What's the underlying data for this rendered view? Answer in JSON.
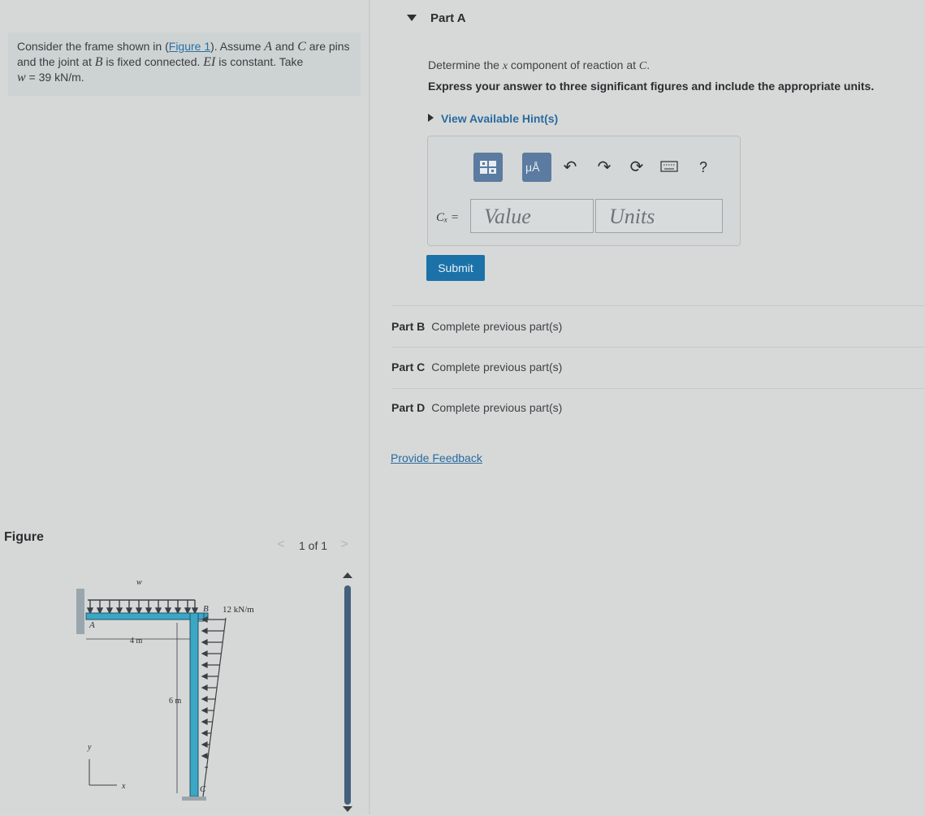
{
  "problem": {
    "intro_1": "Consider the frame shown in (",
    "figure_link": "Figure 1",
    "intro_2": "). Assume ",
    "var_a": "A",
    "and": " and ",
    "var_c": "C",
    "intro_3": " are pins and the joint at ",
    "var_b": "B",
    "intro_4": " is fixed connected. ",
    "var_ei": "EI",
    "intro_5": " is constant. Take",
    "w_label": "w",
    "w_value": " = 39 kN/m."
  },
  "figure": {
    "label": "Figure",
    "pager_count": "1 of 1",
    "prev_glyph": "<",
    "next_glyph": ">",
    "labels": {
      "w": "w",
      "a": "A",
      "b": "B",
      "c": "C",
      "span": "4 m",
      "height": "6 m",
      "load": "12 kN/m",
      "y": "y",
      "x": "x"
    },
    "colors": {
      "member": "#3aa7c4",
      "load": "#3b3f44"
    }
  },
  "part_a": {
    "title": "Part A",
    "question_pre": "Determine the ",
    "question_var": "x",
    "question_mid": " component of reaction at ",
    "question_end": "C",
    "question_dot": ".",
    "instruction": "Express your answer to three significant figures and include the appropriate units.",
    "hints_label": "View Available Hint(s)",
    "answer_label": "Cₓ =",
    "value_placeholder": "Value",
    "units_placeholder": "Units",
    "toolbar": {
      "templates_icon": "templates-icon",
      "units_icon": "units-icon",
      "units_glyph": "μÅ",
      "undo_icon": "undo-icon",
      "redo_icon": "redo-icon",
      "reset_icon": "reset-icon",
      "keyboard_icon": "keyboard-icon",
      "help_glyph": "?"
    },
    "submit_label": "Submit"
  },
  "parts": [
    {
      "label": "Part B",
      "message": "Complete previous part(s)"
    },
    {
      "label": "Part C",
      "message": "Complete previous part(s)"
    },
    {
      "label": "Part D",
      "message": "Complete previous part(s)"
    }
  ],
  "feedback_label": "Provide Feedback",
  "colors": {
    "accent": "#1b72a8",
    "link": "#2a6aa0",
    "toolbar_button": "#5b7ba0"
  }
}
